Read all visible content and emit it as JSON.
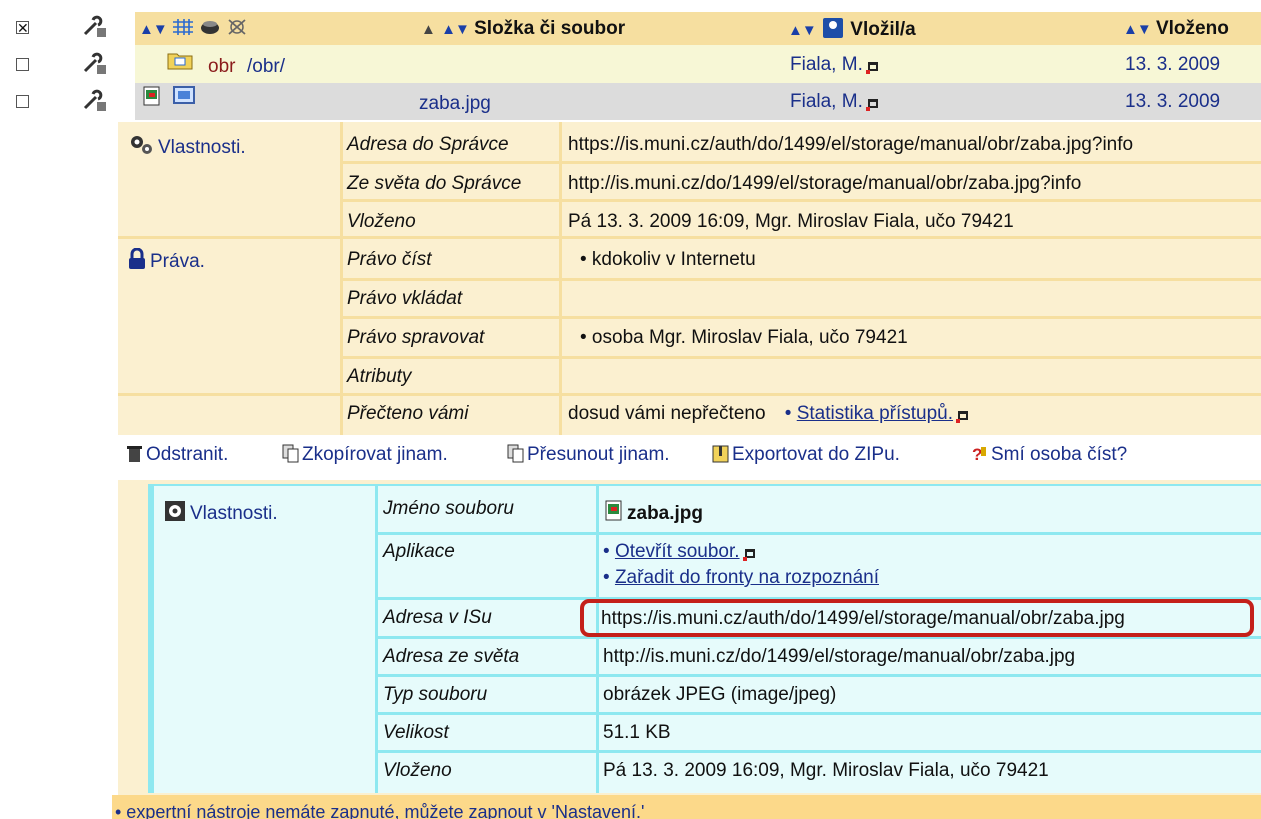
{
  "header": {
    "name_col": "Složka či soubor",
    "author_col": "Vložil/a",
    "date_col": "Vloženo",
    "sort_arrows": "▲▼"
  },
  "rows": [
    {
      "name": "obr",
      "path": "/obr/",
      "author": "Fiala, M.",
      "date": "13. 3. 2009"
    },
    {
      "name": "zaba.jpg",
      "author": "Fiala, M.",
      "date": "13. 3. 2009"
    }
  ],
  "props": {
    "section_label": "Vlastnosti.",
    "rights_label": "Práva.",
    "rows": [
      {
        "key": "Adresa do Správce",
        "value": "https://is.muni.cz/auth/do/1499/el/storage/manual/obr/zaba.jpg?info"
      },
      {
        "key": "Ze světa do Správce",
        "value": "http://is.muni.cz/do/1499/el/storage/manual/obr/zaba.jpg?info"
      },
      {
        "key": "Vloženo",
        "value": "Pá 13. 3. 2009 16:09, Mgr. Miroslav Fiala, učo 79421"
      },
      {
        "key": "Právo číst",
        "value": "• kdokoliv v Internetu"
      },
      {
        "key": "Právo vkládat",
        "value": ""
      },
      {
        "key": "Právo spravovat",
        "value": "• osoba Mgr. Miroslav Fiala, učo 79421"
      },
      {
        "key": "Atributy",
        "value": ""
      },
      {
        "key": "Přečteno vámi",
        "value": "dosud vámi nepřečteno"
      }
    ],
    "stats_link": "Statistika přístupů."
  },
  "actions": {
    "delete": "Odstranit.",
    "copy": "Zkopírovat jinam.",
    "move": "Přesunout jinam.",
    "export": "Exportovat do ZIPu.",
    "can_read": "Smí osoba číst?"
  },
  "detail": {
    "section_label": "Vlastnosti.",
    "rows": [
      {
        "key": "Jméno souboru",
        "value": "zaba.jpg"
      },
      {
        "key": "Aplikace",
        "links": [
          "Otevřít soubor.",
          "Zařadit do fronty na rozpoznání"
        ]
      },
      {
        "key": "Adresa v ISu",
        "value": "https://is.muni.cz/auth/do/1499/el/storage/manual/obr/zaba.jpg"
      },
      {
        "key": "Adresa ze světa",
        "value": "http://is.muni.cz/do/1499/el/storage/manual/obr/zaba.jpg"
      },
      {
        "key": "Typ souboru",
        "value": "obrázek JPEG (image/jpeg)"
      },
      {
        "key": "Velikost",
        "value": "51.1 KB"
      },
      {
        "key": "Vloženo",
        "value": "Pá 13. 3. 2009 16:09, Mgr. Miroslav Fiala, učo 79421"
      }
    ]
  },
  "footer": {
    "note": "• expertní nástroje nemáte zapnuté, můžete zapnout v 'Nastavení.'"
  },
  "colors": {
    "header_bg": "#f6dfa0",
    "folder_row_bg": "#f7f7d6",
    "file_row_bg": "#dcdcdc",
    "props_bg": "#fbf0d0",
    "detail_bg": "#e6fbfb",
    "detail_border": "#8ee8f0",
    "highlight": "#c4201a",
    "link": "#1a2f8a"
  }
}
